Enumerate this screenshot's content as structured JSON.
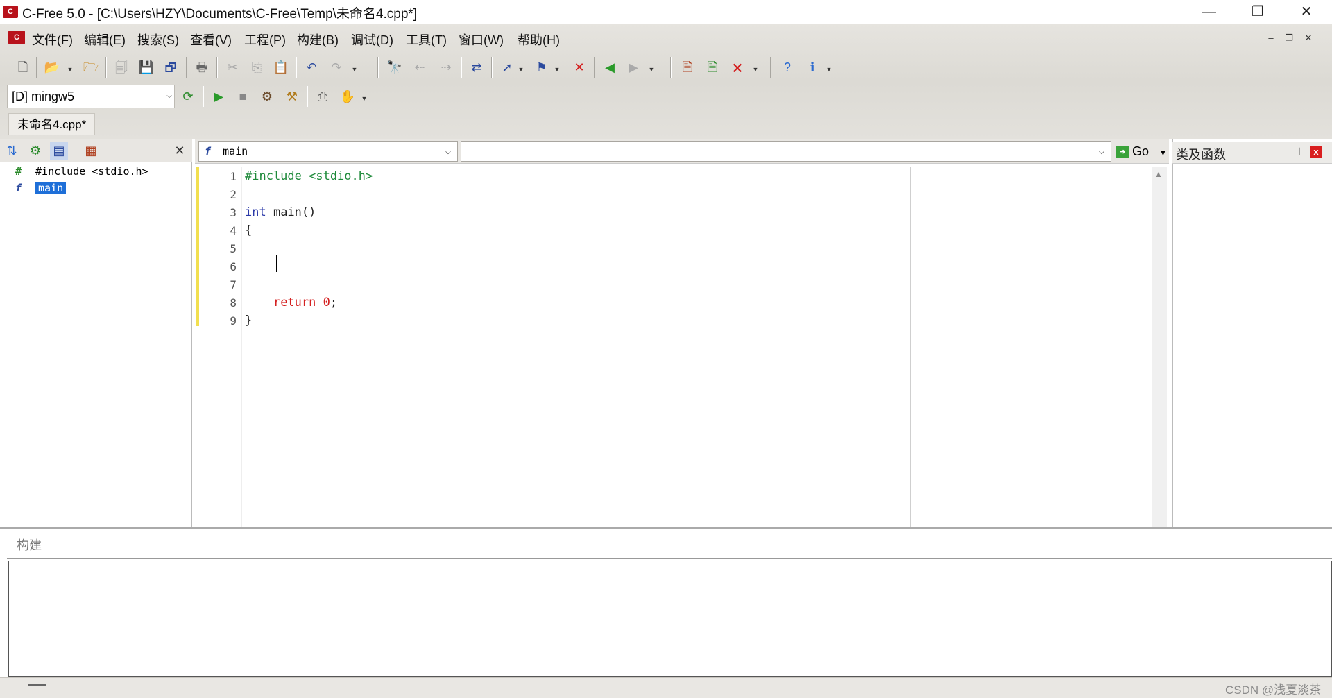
{
  "window": {
    "title": "C-Free 5.0 - [C:\\Users\\HZY\\Documents\\C-Free\\Temp\\未命名4.cpp*]",
    "app_icon_text": "C",
    "controls": {
      "minimize": "—",
      "restore": "❐",
      "close": "✕"
    }
  },
  "menu": {
    "items": [
      "文件(F)",
      "编辑(E)",
      "搜索(S)",
      "查看(V)",
      "工程(P)",
      "构建(B)",
      "调试(D)",
      "工具(T)",
      "窗口(W)",
      "帮助(H)"
    ],
    "mdi_controls": {
      "minimize": "–",
      "restore": "❐",
      "close": "✕"
    }
  },
  "toolbar": {
    "icons": [
      "new-file",
      "open-file",
      "open-project",
      "close-file",
      "save",
      "save-all",
      "print",
      "cut",
      "copy",
      "paste",
      "undo",
      "redo",
      "find",
      "find-prev",
      "find-next",
      "replace",
      "goto",
      "bookmark",
      "clear-bookmark",
      "back",
      "forward",
      "new-project",
      "build-project",
      "close-project",
      "help",
      "info"
    ],
    "compiler": "[D] mingw5"
  },
  "file_tab": "未命名4.cpp*",
  "left_panel": {
    "tree": [
      {
        "icon": "#",
        "label": "#include <stdio.h>",
        "selected": false
      },
      {
        "icon": "f",
        "label": "main",
        "selected": true
      }
    ]
  },
  "editor": {
    "function_combo": "main",
    "go_label": "Go",
    "lines": [
      "1",
      "2",
      "3",
      "4",
      "5",
      "6",
      "7",
      "8",
      "9"
    ],
    "code": {
      "l1": "#include <stdio.h>",
      "l3_kw": "int",
      "l3_rest": " main()",
      "l4": "{",
      "l8_kw": "return",
      "l8_num": "0",
      "l8_end": ";",
      "l9": "}"
    }
  },
  "right_panel": {
    "title": "类及函数",
    "pin": "⊥",
    "close": "x"
  },
  "build_panel": {
    "title": "构建"
  },
  "status": {
    "watermark": "CSDN @浅夏淡茶"
  },
  "colors": {
    "preprocessor": "#1e8a3a",
    "keyword": "#2b39a8",
    "return": "#d42020",
    "selection": "#1e6fd8",
    "change_bar": "#f2df50"
  }
}
